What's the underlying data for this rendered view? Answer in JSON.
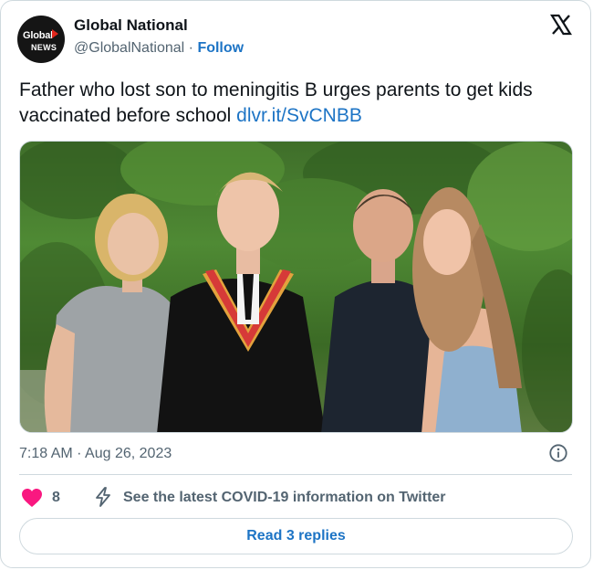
{
  "account": {
    "display_name": "Global National",
    "handle": "@GlobalNational",
    "separator": "·",
    "follow_label": "Follow",
    "avatar": {
      "line1": "Global",
      "line2": "NEWS"
    }
  },
  "platform_icon": "x-logo-icon",
  "tweet": {
    "text": "Father who lost son to meningitis B urges parents to get kids vaccinated before school",
    "link_text": "dlvr.it/SvCNBB"
  },
  "media": {
    "icon": "photo-icon",
    "description_for_alt": "Family of four posing outdoors in front of trees, son wearing graduation gown"
  },
  "meta": {
    "timestamp": "7:18 AM · Aug 26, 2023"
  },
  "actions": {
    "like_count": "8",
    "covid_info": "See the latest COVID-19 information on Twitter"
  },
  "replies_button": "Read 3 replies",
  "colors": {
    "link": "#1d74c5",
    "secondary_text": "#536471",
    "heart": "#f91880",
    "border": "#cfd9de"
  }
}
